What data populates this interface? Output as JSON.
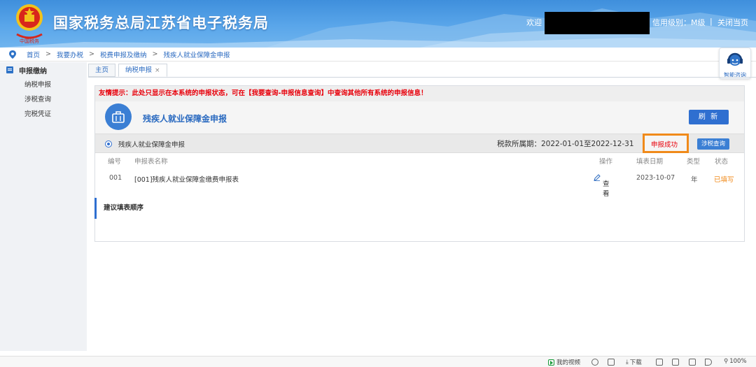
{
  "header": {
    "site_title": "国家税务总局江苏省电子税务局",
    "welcome": "欢迎",
    "credit_level": "信用级别：M级",
    "separator": "|",
    "close_page": "关闭当页"
  },
  "breadcrumb": [
    "首页",
    "我要办税",
    "税费申报及缴纳",
    "残疾人就业保障金申报"
  ],
  "breadcrumb_sep": ">",
  "assistant": {
    "label": "智能咨询"
  },
  "sidebar": {
    "heading": "申报缴纳",
    "items": [
      {
        "label": "纳税申报"
      },
      {
        "label": "涉税查询"
      },
      {
        "label": "完税凭证"
      }
    ]
  },
  "tabs": [
    {
      "label": "主页"
    },
    {
      "label": "纳税申报",
      "close": "×"
    }
  ],
  "panel": {
    "tip": "友情提示：此处只显示在本系统的申报状态，可在【我要查询-申报信息查询】中查询其他所有系统的申报信息！",
    "title": "残疾人就业保障金申报",
    "refresh_label": "刷 新",
    "form_name": "残疾人就业保障金申报",
    "period": "税款所属期：2022-01-01至2022-12-31",
    "status": "申报成功",
    "query_button": "涉税查询",
    "table": {
      "headers": [
        "编号",
        "申报表名称",
        "操作",
        "填表日期",
        "类型",
        "状态"
      ],
      "rows": [
        {
          "no": "001",
          "name": "[001]残疾人就业保障金缴费申报表",
          "op": "查看",
          "date": "2023-10-07",
          "type": "年",
          "state": "已填写"
        }
      ]
    },
    "order_title": "建议填表顺序"
  },
  "statusbar": {
    "my_video": "我的视频",
    "download": "下载",
    "zoom": "100%"
  },
  "colors": {
    "header_blue": "#4b9be4",
    "link_blue": "#2a6ac0",
    "button_blue": "#2f6fd0",
    "tip_red": "#e8000b",
    "highlight_orange": "#f08a1a"
  }
}
